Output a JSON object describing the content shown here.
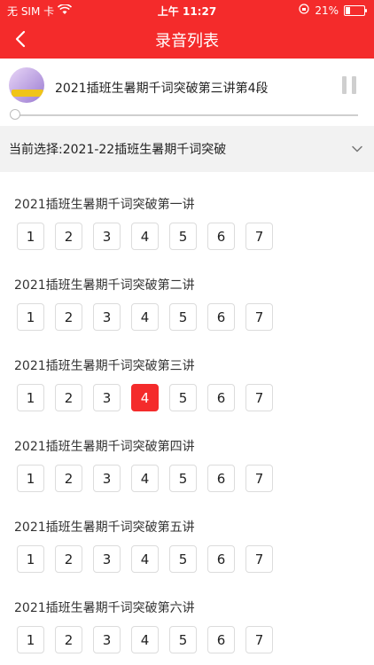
{
  "status": {
    "carrier": "无 SIM 卡",
    "time": "上午 11:27",
    "battery": "21%"
  },
  "nav": {
    "title": "录音列表"
  },
  "player": {
    "track_title": "2021插班生暑期千词突破第三讲第4段",
    "progress": 0.0
  },
  "selector": {
    "label": "当前选择:2021-22插班生暑期千词突破"
  },
  "sections": [
    {
      "title": "2021插班生暑期千词突破第一讲",
      "parts": [
        "1",
        "2",
        "3",
        "4",
        "5",
        "6",
        "7"
      ],
      "active": -1
    },
    {
      "title": "2021插班生暑期千词突破第二讲",
      "parts": [
        "1",
        "2",
        "3",
        "4",
        "5",
        "6",
        "7"
      ],
      "active": -1
    },
    {
      "title": "2021插班生暑期千词突破第三讲",
      "parts": [
        "1",
        "2",
        "3",
        "4",
        "5",
        "6",
        "7"
      ],
      "active": 3
    },
    {
      "title": "2021插班生暑期千词突破第四讲",
      "parts": [
        "1",
        "2",
        "3",
        "4",
        "5",
        "6",
        "7"
      ],
      "active": -1
    },
    {
      "title": "2021插班生暑期千词突破第五讲",
      "parts": [
        "1",
        "2",
        "3",
        "4",
        "5",
        "6",
        "7"
      ],
      "active": -1
    },
    {
      "title": "2021插班生暑期千词突破第六讲",
      "parts": [
        "1",
        "2",
        "3",
        "4",
        "5",
        "6",
        "7"
      ],
      "active": -1
    }
  ],
  "colors": {
    "accent": "#f42b2b"
  }
}
